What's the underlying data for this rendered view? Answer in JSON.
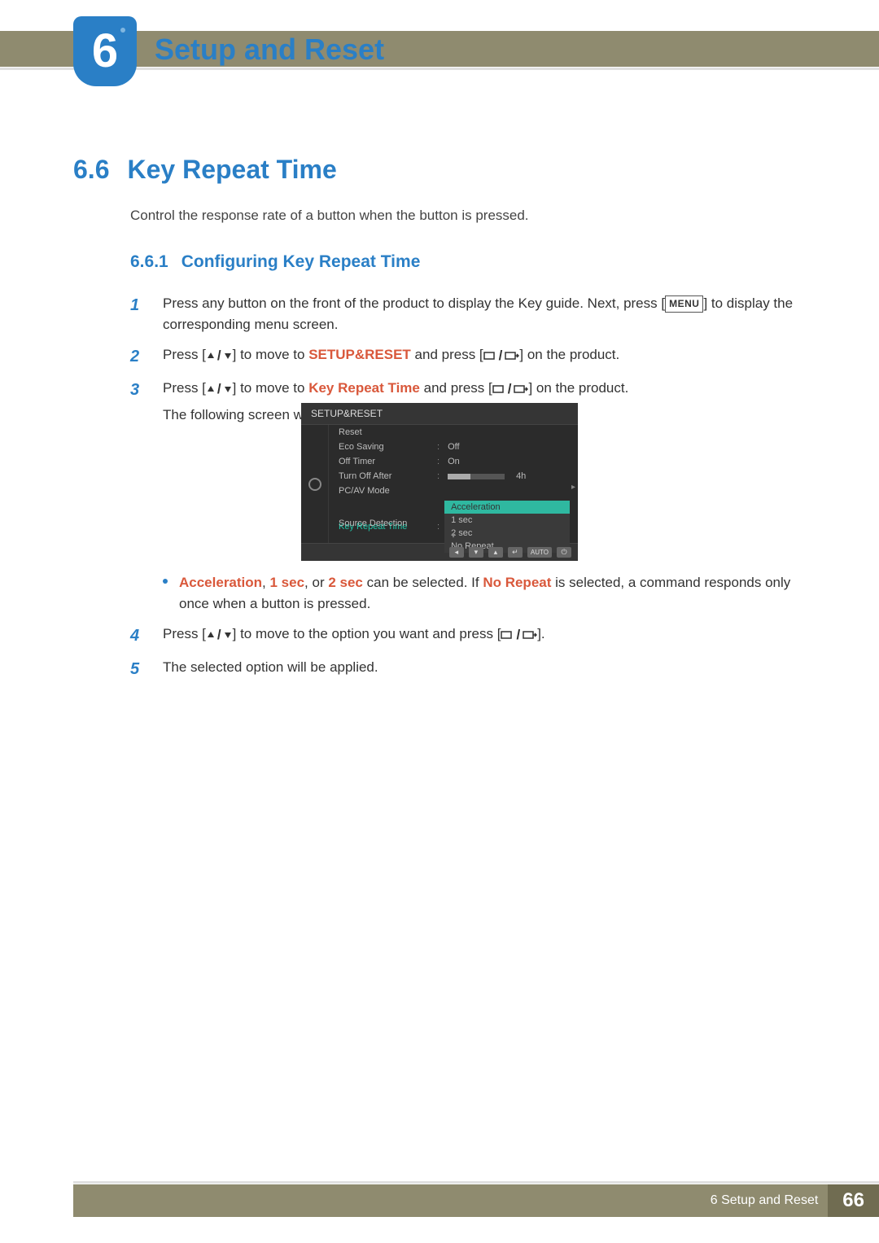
{
  "chapter": {
    "number": "6",
    "title": "Setup and Reset"
  },
  "section": {
    "num": "6.6",
    "title": "Key Repeat Time",
    "desc": "Control the response rate of a button when the button is pressed."
  },
  "subsection": {
    "num": "6.6.1",
    "title": "Configuring Key Repeat Time"
  },
  "step1": {
    "pre": "Press any button on the front of the product to display the Key guide. Next, press [",
    "menu": "MENU",
    "post": "] to display the corresponding menu screen."
  },
  "step2": {
    "pre": "Press [",
    "mid": "] to move to ",
    "target": "SETUP&RESET",
    "mid2": " and press [",
    "post": "] on the product."
  },
  "step3": {
    "pre": "Press [",
    "mid": "] to move to ",
    "target": "Key Repeat Time",
    "mid2": " and press [",
    "post": "] on the product.",
    "line2": "The following screen will appear."
  },
  "bullet": {
    "a": "Acceleration",
    "sep1": ", ",
    "b": "1 sec",
    "sep2": ", or ",
    "c": "2 sec",
    "mid": " can be selected. If ",
    "d": "No Repeat",
    "tail": " is selected, a command responds only once when a button is pressed."
  },
  "step4": {
    "pre": "Press [",
    "mid": "] to move to the option you want and press [",
    "post": "]."
  },
  "step5": "The selected option will be applied.",
  "osd": {
    "title": "SETUP&RESET",
    "rows": {
      "reset": "Reset",
      "eco": "Eco Saving",
      "eco_val": "Off",
      "off_timer": "Off Timer",
      "off_timer_val": "On",
      "turn_off": "Turn Off After",
      "turn_off_val": "4h",
      "pcav": "PC/AV Mode",
      "krt": "Key Repeat Time",
      "src": "Source Detection"
    },
    "dropdown": [
      "Acceleration",
      "1 sec",
      "2 sec",
      "No Repeat"
    ],
    "footer_auto": "AUTO"
  },
  "footer": {
    "label": "6 Setup and Reset",
    "page": "66"
  }
}
